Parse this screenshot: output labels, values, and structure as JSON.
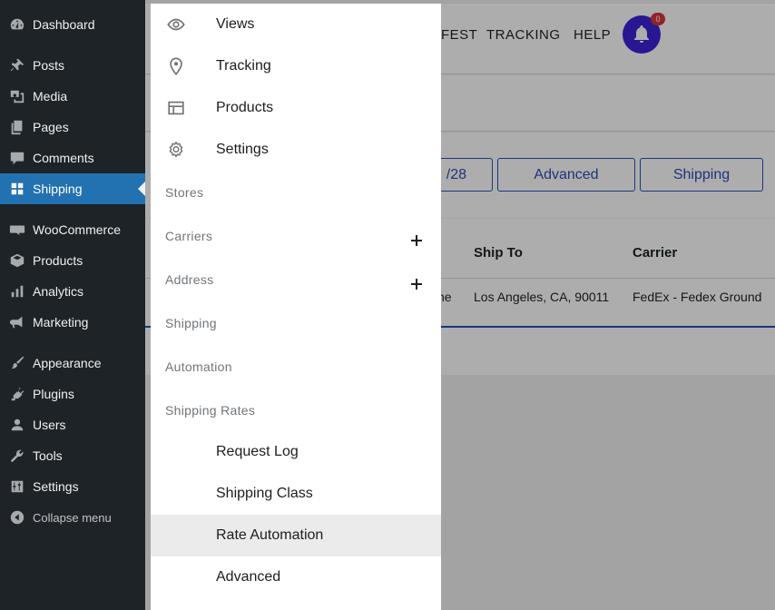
{
  "wp_sidebar": {
    "items": [
      {
        "label": "Dashboard",
        "icon": "dashboard-icon"
      },
      {
        "label": "Posts",
        "icon": "pin-icon"
      },
      {
        "label": "Media",
        "icon": "media-icon"
      },
      {
        "label": "Pages",
        "icon": "pages-icon"
      },
      {
        "label": "Comments",
        "icon": "comments-icon"
      },
      {
        "label": "Shipping",
        "icon": "grid-icon",
        "active": true
      },
      {
        "label": "WooCommerce",
        "icon": "woo-icon"
      },
      {
        "label": "Products",
        "icon": "box-icon"
      },
      {
        "label": "Analytics",
        "icon": "bar-chart-icon"
      },
      {
        "label": "Marketing",
        "icon": "megaphone-icon"
      },
      {
        "label": "Appearance",
        "icon": "paintbrush-icon"
      },
      {
        "label": "Plugins",
        "icon": "plug-icon"
      },
      {
        "label": "Users",
        "icon": "user-icon"
      },
      {
        "label": "Tools",
        "icon": "wrench-icon"
      },
      {
        "label": "Settings",
        "icon": "sliders-icon"
      },
      {
        "label": "Collapse menu",
        "icon": "collapse-icon"
      }
    ]
  },
  "app": {
    "nav": {
      "manifest_partial": "FEST",
      "tracking": "TRACKING",
      "help": "HELP"
    },
    "notifications_count": "0",
    "filters": {
      "date_partial": "/28",
      "advanced": "Advanced",
      "shipping": "Shipping"
    },
    "table": {
      "headers": {
        "ship_to": "Ship To",
        "carrier": "Carrier"
      },
      "row": {
        "partial": "ne",
        "ship_to": "Los Angeles, CA, 90011",
        "carrier": "FedEx - Fedex Ground"
      }
    }
  },
  "drawer": {
    "top_items": [
      {
        "label": "Views",
        "icon": "eye-icon"
      },
      {
        "label": "Tracking",
        "icon": "map-pin-icon"
      },
      {
        "label": "Products",
        "icon": "table-layout-icon"
      },
      {
        "label": "Settings",
        "icon": "gear-icon"
      }
    ],
    "sections": [
      {
        "label": "Stores"
      },
      {
        "label": "Carriers",
        "expandable": true
      },
      {
        "label": "Address",
        "expandable": true
      },
      {
        "label": "Shipping"
      },
      {
        "label": "Automation"
      },
      {
        "label": "Shipping Rates"
      }
    ],
    "sub_items": [
      {
        "label": "Request Log"
      },
      {
        "label": "Shipping Class"
      },
      {
        "label": "Rate Automation",
        "selected": true
      },
      {
        "label": "Advanced"
      }
    ]
  },
  "colors": {
    "wp_sidebar_bg": "#1d2327",
    "wp_active": "#2271b1",
    "brand_blue": "#2b4db5",
    "bell_bg": "#3b23d9",
    "badge": "#d63638"
  }
}
